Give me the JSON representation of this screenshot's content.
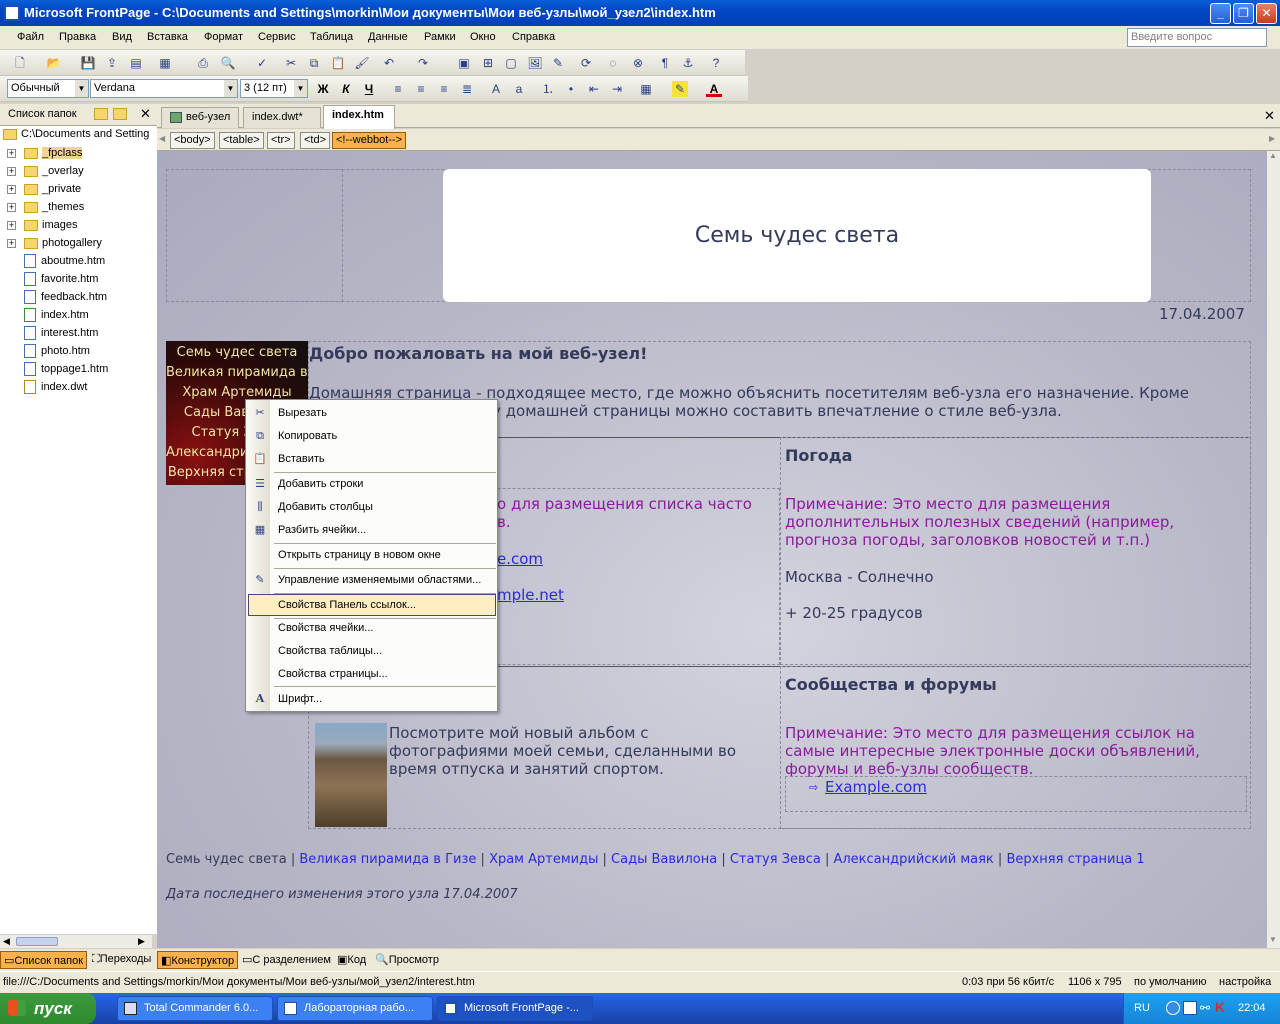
{
  "window": {
    "title": "Microsoft FrontPage - C:\\Documents and Settings\\morkin\\Мои документы\\Мои веб-узлы\\мой_узел2\\index.htm",
    "minimize": "_",
    "maximize": "❐",
    "close": "✕"
  },
  "menu": {
    "items": [
      "Файл",
      "Правка",
      "Вид",
      "Вставка",
      "Формат",
      "Сервис",
      "Таблица",
      "Данные",
      "Рамки",
      "Окно",
      "Справка"
    ],
    "help_placeholder": "Введите вопрос"
  },
  "format_toolbar": {
    "style": "Обычный",
    "font": "Verdana",
    "size": "3 (12 пт)",
    "bold": "Ж",
    "italic": "К",
    "underline": "Ч"
  },
  "folder_pane": {
    "title": "Список папок",
    "root": "C:\\Documents and Setting",
    "folders": [
      "_fpclass",
      "_overlay",
      "_private",
      "_themes",
      "images",
      "photogallery"
    ],
    "files": [
      "aboutme.htm",
      "favorite.htm",
      "feedback.htm",
      "index.htm",
      "interest.htm",
      "photo.htm",
      "toppage1.htm",
      "index.dwt"
    ],
    "bottom_tabs": [
      "Список папок",
      "Переходы"
    ]
  },
  "doc_tabs": [
    "веб-узел",
    "index.dwt*",
    "index.htm"
  ],
  "tag_selector": [
    "<body>",
    "<table>",
    "<tr>",
    "<td>",
    "<!--webbot-->"
  ],
  "page": {
    "site_title": "Семь чудес света",
    "date": "17.04.2007",
    "nav_items": [
      "Семь чудес света",
      "Великая пирамида в Гизе",
      "Храм Артемиды",
      "Сады Вавилона",
      "Статуя Зевса",
      "Александрийский маяк",
      "Верхняя страница 1"
    ],
    "welcome_heading": "Добро пожаловать на мой веб-узел!",
    "welcome_text_1": "Домашняя страница - подходящее место, где можно объяснить посетителям веб-узла его назначение. Кроме",
    "welcome_text_2": "у домашней страницы можно составить впечатление о стиле веб-узла.",
    "left_note_1": "о для размещения списка часто",
    "left_note_2": "в.",
    "left_link_1": "e.com",
    "left_link_2": "mple.net",
    "weather_heading": "Погода",
    "weather_note_1": "Примечание: Это место для размещения",
    "weather_note_2": "дополнительных полезных сведений (например,",
    "weather_note_3": "прогноза погоды, заголовков новостей и т.п.)",
    "weather_city": "Москва - Солнечно",
    "weather_temp": "+ 20-25 градусов",
    "forums_heading": "Сообщества и форумы",
    "forums_note_1": "Примечание: Это место для размещения ссылок на",
    "forums_note_2": "самые интересные электронные доски объявлений,",
    "forums_note_3": "форумы и веб-узлы сообществ.",
    "forums_link": "Example.com",
    "album_text_1": "Посмотрите мой новый альбом с",
    "album_text_2": "фотографиями моей семьи, сделанными во",
    "album_text_3": "время отпуска и занятий спортом.",
    "footer_nav": [
      "Семь чудес света",
      "Великая пирамида в Гизе",
      "Храм Артемиды",
      "Сады Вавилона",
      "Статуя Зевса",
      "Александрийский маяк",
      "Верхняя страница 1"
    ],
    "footer_sep": "|",
    "modified": "Дата последнего изменения этого узла 17.04.2007"
  },
  "context_menu": {
    "items": [
      "Вырезать",
      "Копировать",
      "Вставить",
      "Добавить строки",
      "Добавить столбцы",
      "Разбить ячейки...",
      "Открыть страницу в новом окне",
      "Управление изменяемыми областями...",
      "Свойства Панель ссылок...",
      "Свойства ячейки...",
      "Свойства таблицы...",
      "Свойства страницы...",
      "Шрифт..."
    ],
    "highlighted": "Свойства Панель ссылок..."
  },
  "view_tabs": [
    "Конструктор",
    "С разделением",
    "Код",
    "Просмотр"
  ],
  "status": {
    "path": "file:///C:/Documents and Settings/morkin/Мои документы/Мои веб-узлы/мой_узел2/interest.htm",
    "time": "0:03 при 56 кбит/с",
    "resolution": "1106 x 795",
    "mode": "по умолчанию",
    "custom": "настройка"
  },
  "taskbar": {
    "start": "пуск",
    "tasks": [
      "Total Commander 6.0...",
      "Лабораторная рабо...",
      "Microsoft FrontPage -..."
    ],
    "lang": "RU",
    "clock": "22:04"
  }
}
